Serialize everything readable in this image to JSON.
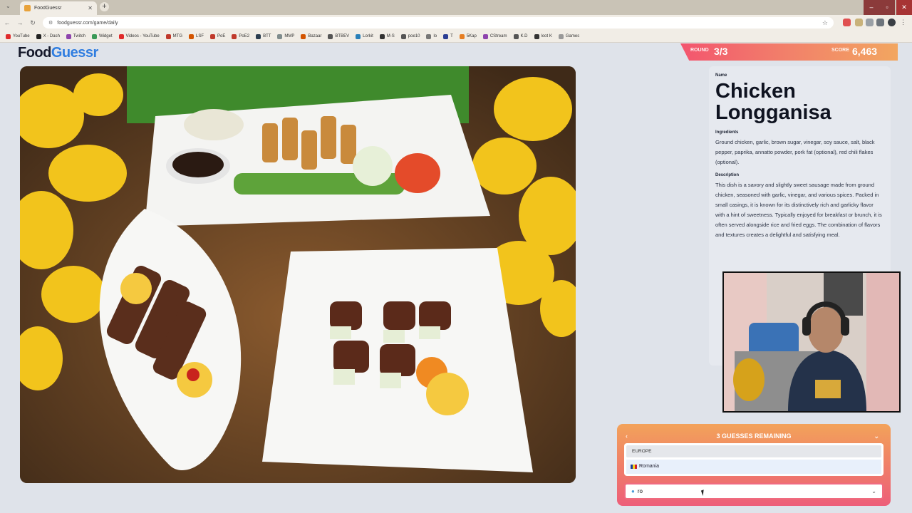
{
  "browser": {
    "tab_title": "FoodGuessr",
    "url": "foodguessr.com/game/daily",
    "bookmarks": [
      "YouTube",
      "X - Dash",
      "Twitch",
      "Widget",
      "Videos - YouTube",
      "MTG",
      "LSF",
      "PoE",
      "PoE2",
      "BTT",
      "MMP",
      "Bazaar",
      "BTBEV",
      "Lorkit",
      "M-S",
      "poe10",
      "lo",
      "T",
      "5Kap",
      "CStream",
      "K.D",
      "loot K",
      "Games"
    ]
  },
  "header": {
    "logo_part1": "Food",
    "logo_part2": "Guessr"
  },
  "scoreboard": {
    "round_label": "ROUND",
    "round_value": "3/3",
    "score_label": "SCORE",
    "score_value": "6,463"
  },
  "dish": {
    "name_label": "Name",
    "name": "Chicken Longganisa",
    "ingredients_label": "Ingredients",
    "ingredients": "Ground chicken, garlic, brown sugar, vinegar, soy sauce, salt, black pepper, paprika, annatto powder, pork fat (optional), red chili flakes (optional).",
    "description_label": "Description",
    "description": "This dish is a savory and slightly sweet sausage made from ground chicken, seasoned with garlic, vinegar, and various spices. Packed in small casings, it is known for its distinctively rich and garlicky flavor with a hint of sweetness. Typically enjoyed for breakfast or brunch, it is often served alongside rice and fried eggs. The combination of flavors and textures creates a delightful and satisfying meal."
  },
  "guess": {
    "remaining_label": "3 GUESSES REMAINING",
    "group_label": "EUROPE",
    "option_label": "Romania",
    "input_value": "ro",
    "colors": {
      "gradient_top": "#f3a35a",
      "gradient_bottom": "#ed5e79",
      "accent": "#f06b80"
    }
  }
}
